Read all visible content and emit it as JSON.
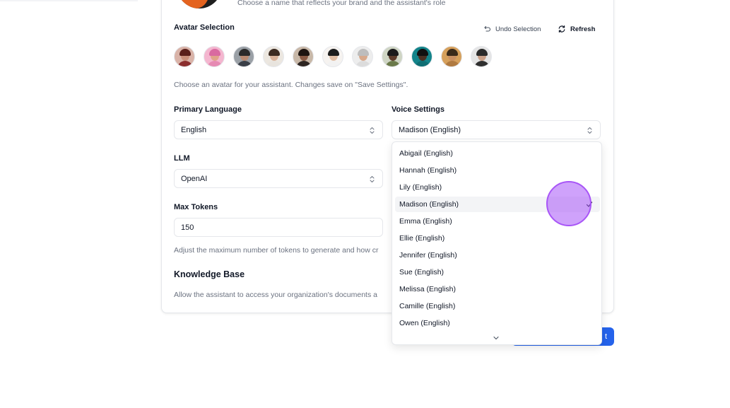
{
  "header": {
    "name_hint": "Choose a name that reflects your brand and the assistant's role"
  },
  "avatar_section": {
    "label": "Avatar Selection",
    "undo_label": "Undo Selection",
    "refresh_label": "Refresh",
    "helper": "Choose an avatar for your assistant. Changes save on \"Save Settings\".",
    "avatars": [
      {
        "skin": "#c98f7a",
        "hair": "#5a1f1a",
        "shirt": "#8b2e2e",
        "bg": "#d9b3a8"
      },
      {
        "skin": "#e0a38a",
        "hair": "#d96aa0",
        "shirt": "#e68ab3",
        "bg": "#f4b6cf"
      },
      {
        "skin": "#b88a72",
        "hair": "#2a2a2a",
        "shirt": "#3a3f47",
        "bg": "#9aa0a6"
      },
      {
        "skin": "#d8b29a",
        "hair": "#3b2a20",
        "shirt": "#e8e4de",
        "bg": "#ece7e0"
      },
      {
        "skin": "#8a5a44",
        "hair": "#1e1410",
        "shirt": "#2e2622",
        "bg": "#c8b8a8"
      },
      {
        "skin": "#e1bfa6",
        "hair": "#1c1c1c",
        "shirt": "#f2f2f2",
        "bg": "#f6f3f0"
      },
      {
        "skin": "#d7a98c",
        "hair": "#bdbdbd",
        "shirt": "#dcdcdc",
        "bg": "#ededed"
      },
      {
        "skin": "#5c3b2a",
        "hair": "#1a1a1a",
        "shirt": "#6b7a4a",
        "bg": "#cfd5c4"
      },
      {
        "skin": "#4a2f22",
        "hair": "#111111",
        "shirt": "#0f6e73",
        "bg": "#13848a"
      },
      {
        "skin": "#c88f62",
        "hair": "#3a2a1a",
        "shirt": "#b07a40",
        "bg": "#d6a05c"
      },
      {
        "skin": "#c9a088",
        "hair": "#2b2b2b",
        "shirt": "#2f2f2f",
        "bg": "#e5e5e5"
      }
    ]
  },
  "language": {
    "label": "Primary Language",
    "value": "English"
  },
  "voice": {
    "label": "Voice Settings",
    "value": "Madison (English)",
    "options": [
      "Abigail (English)",
      "Hannah (English)",
      "Lily (English)",
      "Madison (English)",
      "Emma (English)",
      "Ellie (English)",
      "Jennifer (English)",
      "Sue (English)",
      "Melissa (English)",
      "Camille (English)",
      "Owen (English)"
    ],
    "selected_index": 3
  },
  "llm": {
    "label": "LLM",
    "value": "OpenAI"
  },
  "max_tokens": {
    "label": "Max Tokens",
    "value": "150",
    "helper": "Adjust the maximum number of tokens to generate and how cr"
  },
  "knowledge_base": {
    "title": "Knowledge Base",
    "helper": "Allow the assistant to access your organization's documents a"
  },
  "footer": {
    "primary_label": "t"
  },
  "colors": {
    "primary": "#2563eb",
    "cursor": "#a855f7"
  }
}
